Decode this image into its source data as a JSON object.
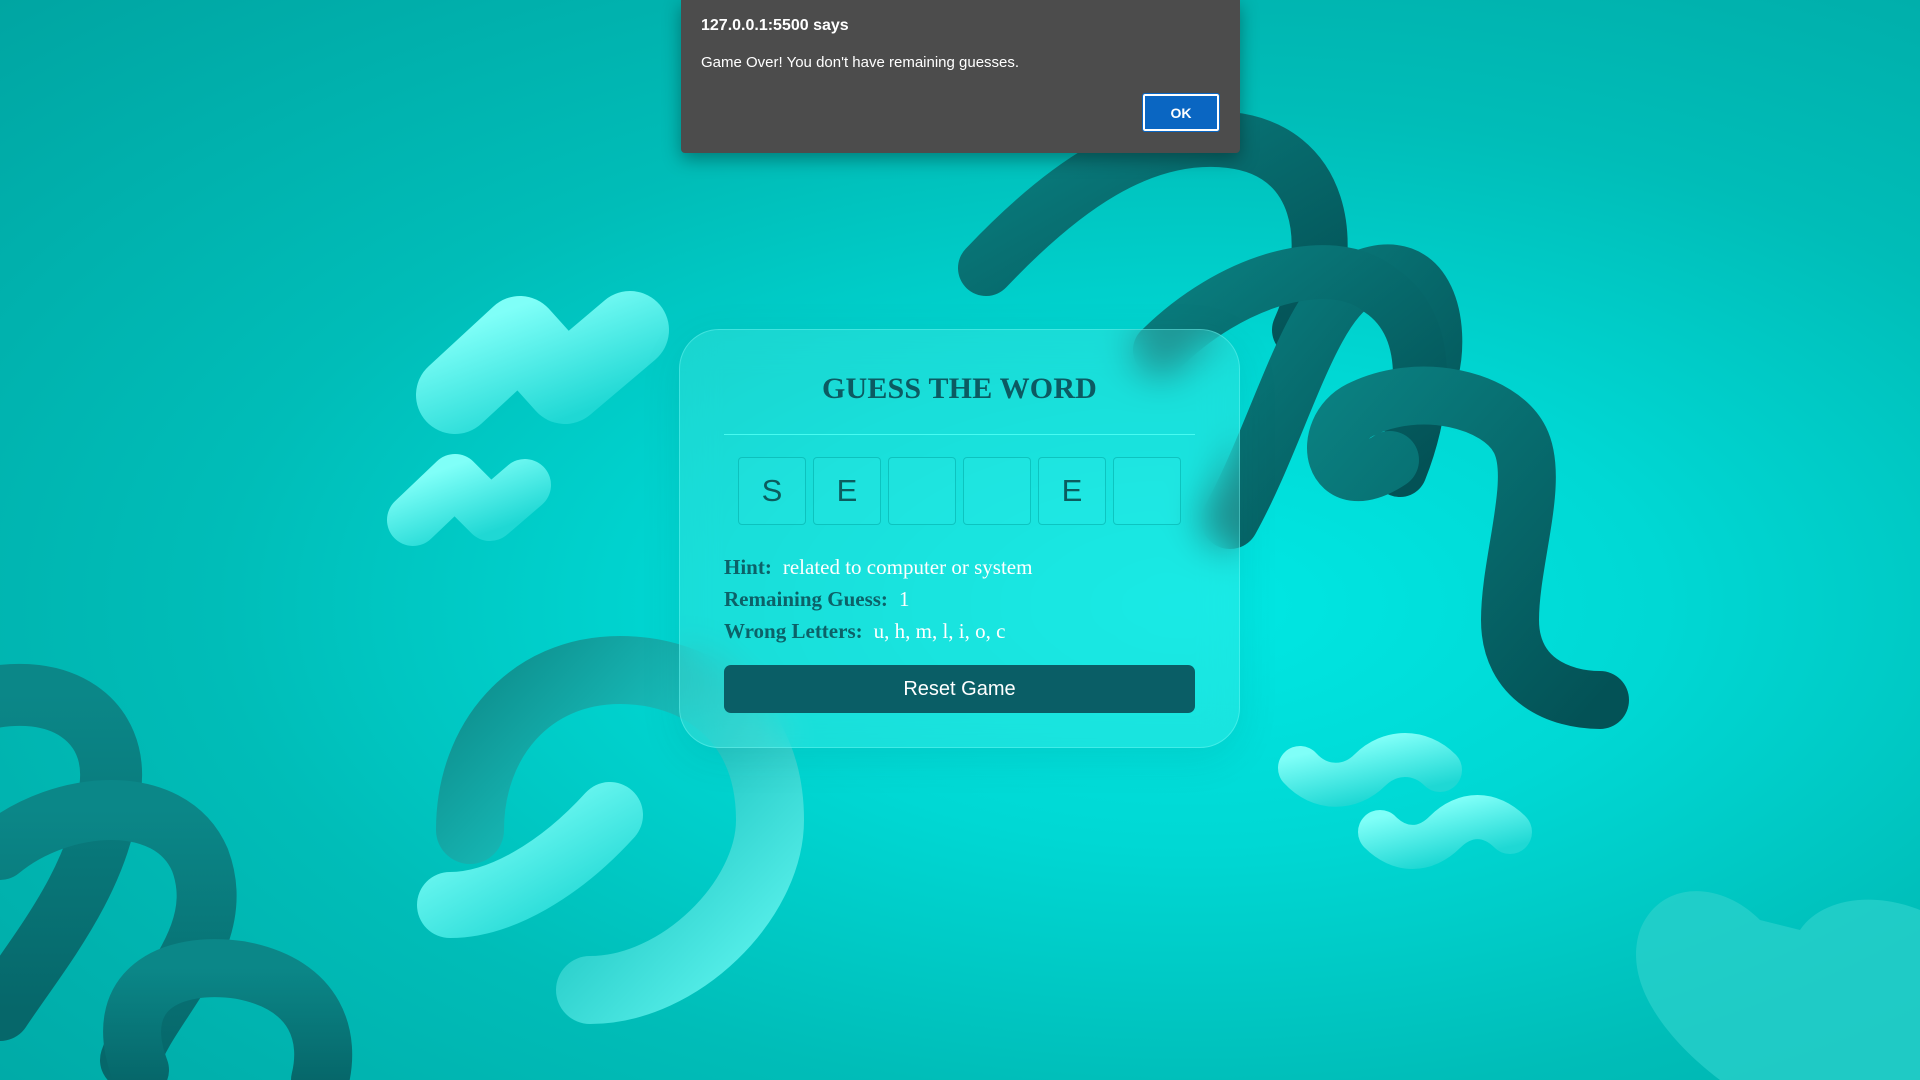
{
  "colors": {
    "background": "#00d8d4",
    "title": "#0c5a62",
    "label": "#0c6168",
    "button": "#0a5e66",
    "dialog_bg": "#4c4c4c",
    "dialog_ok": "#0a66c2"
  },
  "dialog": {
    "title": "127.0.0.1:5500 says",
    "message": "Game Over! You don't have remaining guesses.",
    "ok_label": "OK"
  },
  "game": {
    "title": "GUESS THE WORD",
    "letters": [
      "S",
      "E",
      "",
      "",
      "E",
      ""
    ],
    "hint_label": "Hint:",
    "hint_value": "related to computer or system",
    "remaining_label": "Remaining Guess:",
    "remaining_value": "1",
    "wrong_label": "Wrong Letters:",
    "wrong_value": "u, h, m, l, i, o, c",
    "reset_label": "Reset Game"
  }
}
